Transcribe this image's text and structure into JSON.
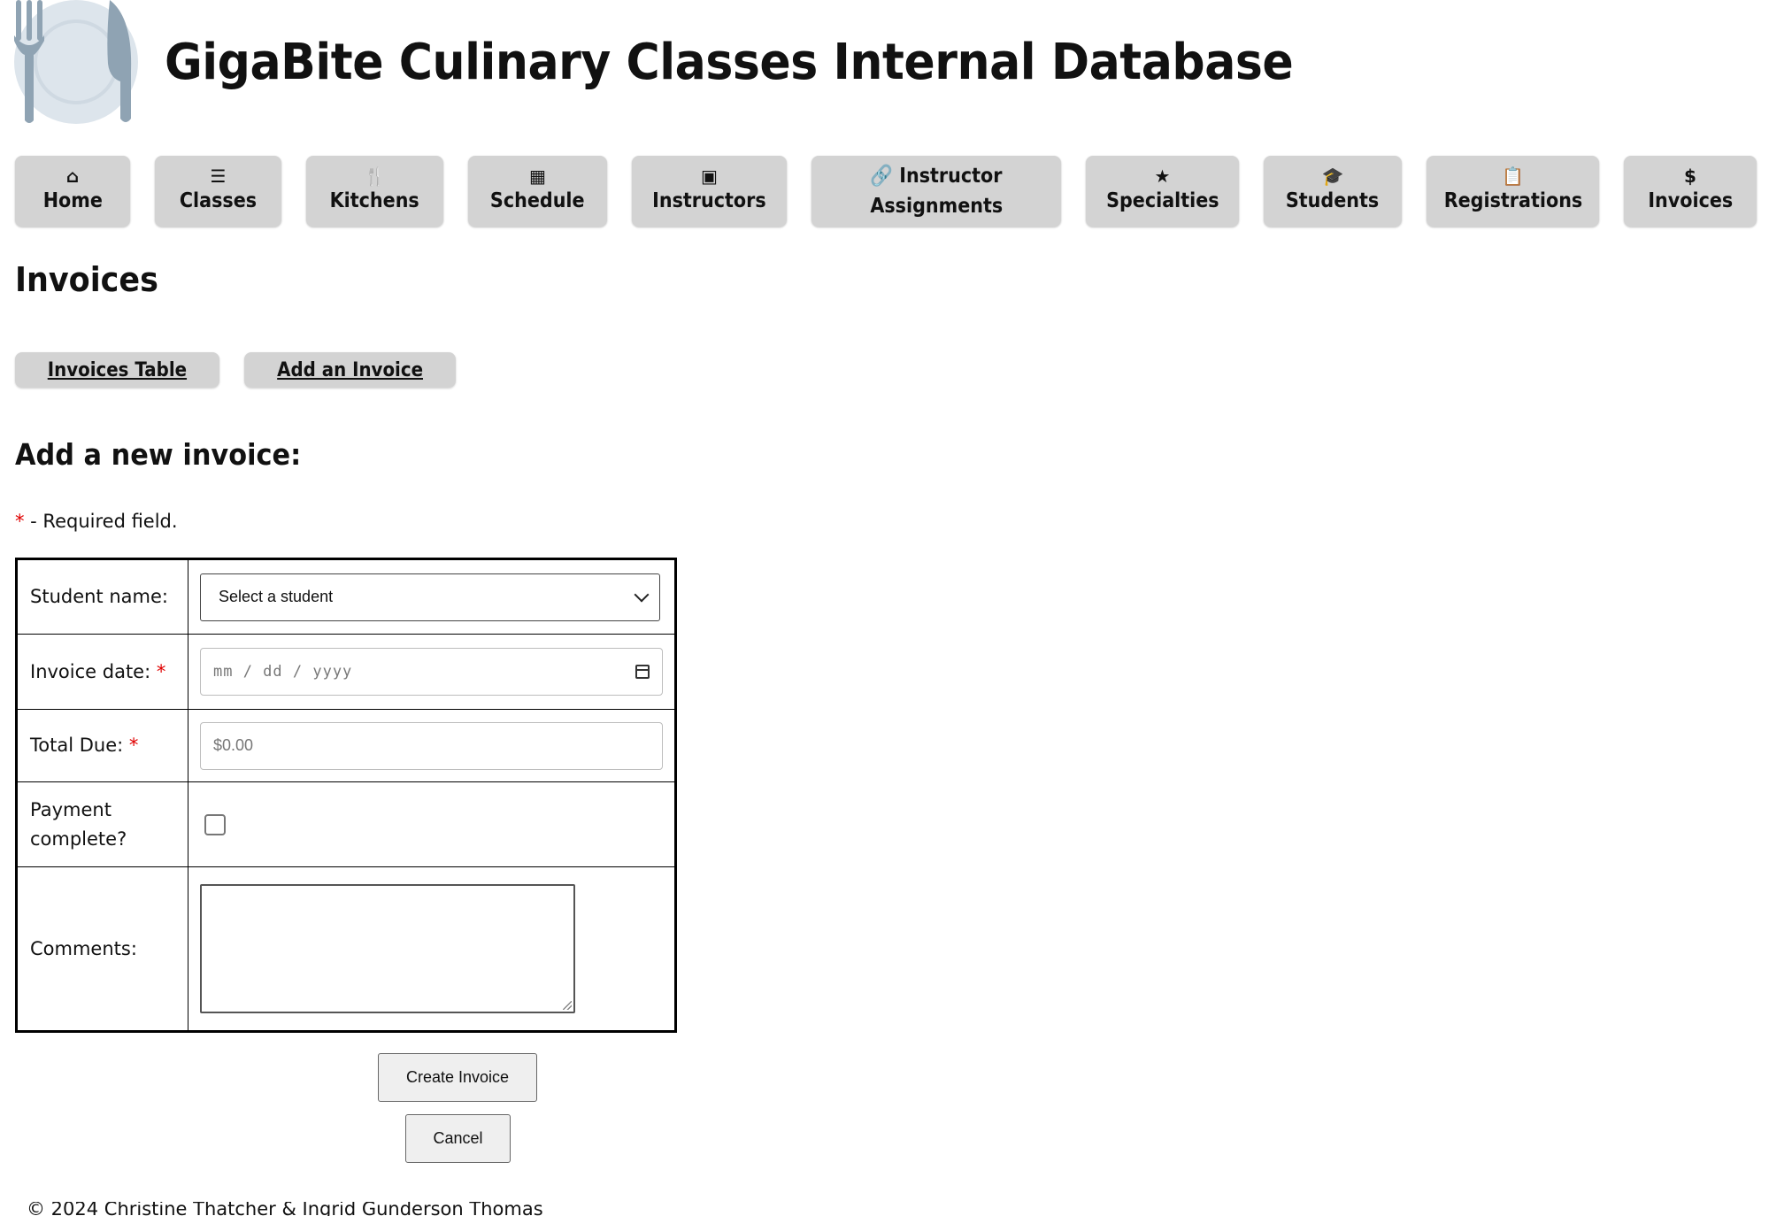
{
  "header": {
    "title": "GigaBite Culinary Classes Internal Database",
    "logo_icon": "plate-fork-knife-icon"
  },
  "nav": [
    {
      "label": "Home",
      "icon": "house-icon",
      "glyph": "⌂"
    },
    {
      "label": "Classes",
      "icon": "list-icon",
      "glyph": "☰"
    },
    {
      "label": "Kitchens",
      "icon": "utensils-icon",
      "glyph": "🍴"
    },
    {
      "label": "Schedule",
      "icon": "calendar-icon",
      "glyph": "▦"
    },
    {
      "label": "Instructors",
      "icon": "chalkboard-icon",
      "glyph": "▣"
    },
    {
      "label_line1": "Instructor",
      "label_line2": "Assignments",
      "icon": "link-icon",
      "glyph": "🔗"
    },
    {
      "label": "Specialties",
      "icon": "star-icon",
      "glyph": "★"
    },
    {
      "label": "Students",
      "icon": "graduation-cap-icon",
      "glyph": "🎓"
    },
    {
      "label": "Registrations",
      "icon": "clipboard-icon",
      "glyph": "📋"
    },
    {
      "label": "Invoices",
      "icon": "dollar-circle-icon",
      "glyph": "$"
    }
  ],
  "page": {
    "heading": "Invoices"
  },
  "subnav": {
    "table_link": "Invoices Table",
    "add_link": "Add an Invoice"
  },
  "form": {
    "heading": "Add a new invoice:",
    "required_star": "*",
    "required_note": " - Required field.",
    "student_label": "Student name:",
    "student_select_value": "Select a student",
    "date_label": "Invoice date:",
    "date_placeholder": "mm / dd / yyyy",
    "total_label": "Total Due:",
    "total_placeholder": "$0.00",
    "payment_label_line1": "Payment",
    "payment_label_line2": "complete?",
    "payment_checked": false,
    "comments_label": "Comments:",
    "comments_value": "",
    "submit_label": "Create Invoice",
    "cancel_label": "Cancel"
  },
  "footer": {
    "text": "© 2024 Christine Thatcher & Ingrid Gunderson Thomas"
  },
  "colors": {
    "nav_bg": "#d3d3d3",
    "required": "#e00000",
    "logo_plate": "#dde5ec",
    "logo_utensil": "#8fa3b3"
  }
}
